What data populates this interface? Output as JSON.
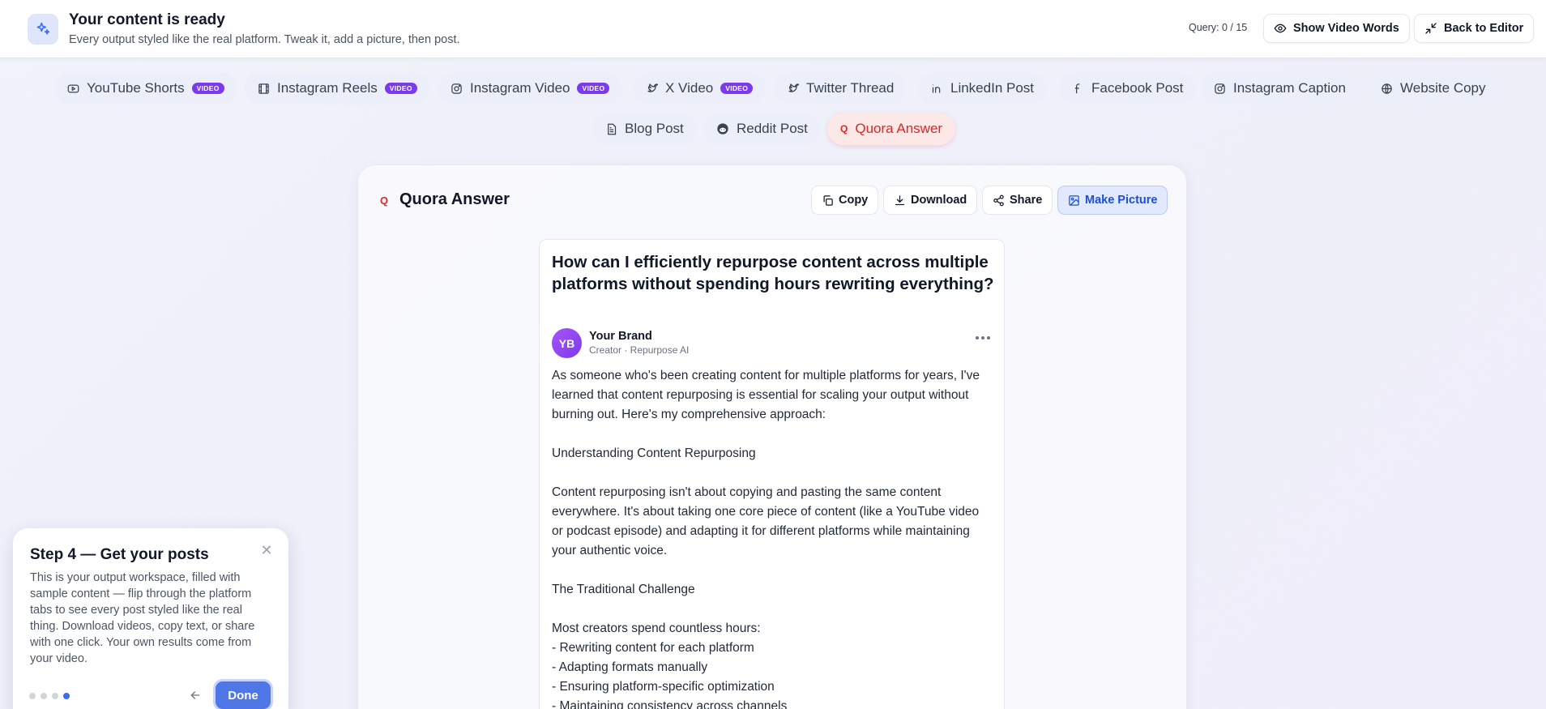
{
  "header": {
    "title": "Your content is ready",
    "subtitle": "Every output styled like the real platform. Tweak it, add a picture, then post.",
    "query": "Query: 0 / 15",
    "show_words_label": "Show Video Words",
    "back_label": "Back to Editor",
    "logo_icon": "sparkles-icon"
  },
  "tabs": [
    {
      "label": "YouTube Shorts",
      "badge": "VIDEO",
      "icon": "youtube-icon"
    },
    {
      "label": "Instagram Reels",
      "badge": "VIDEO",
      "icon": "film-icon"
    },
    {
      "label": "Instagram Video",
      "badge": "VIDEO",
      "icon": "instagram-icon"
    },
    {
      "label": "X Video",
      "badge": "VIDEO",
      "icon": "twitter-icon"
    },
    {
      "label": "Twitter Thread",
      "icon": "twitter-icon"
    },
    {
      "label": "LinkedIn Post",
      "icon": "linkedin-icon"
    },
    {
      "label": "Facebook Post",
      "icon": "facebook-icon"
    },
    {
      "label": "Instagram Caption",
      "icon": "instagram-icon"
    },
    {
      "label": "Website Copy",
      "icon": "globe-icon"
    },
    {
      "label": "Blog Post",
      "icon": "file-icon"
    },
    {
      "label": "Reddit Post",
      "icon": "reddit-icon"
    },
    {
      "label": "Quora Answer",
      "icon": "quora-icon",
      "active": true
    }
  ],
  "card": {
    "title": "Quora Answer",
    "copy_label": "Copy",
    "download_label": "Download",
    "share_label": "Share",
    "picture_label": "Make Picture"
  },
  "post": {
    "question": "How can I efficiently repurpose content across multiple platforms without spending hours rewriting everything?",
    "avatar_initials": "YB",
    "author": "Your Brand",
    "author_sub": "Creator · Repurpose AI",
    "paragraphs": [
      "As someone who's been creating content for multiple platforms for years, I've learned that content repurposing is essential for scaling your output without burning out. Here's my comprehensive approach:",
      "Understanding Content Repurposing",
      "Content repurposing isn't about copying and pasting the same content everywhere. It's about taking one core piece of content (like a YouTube video or podcast episode) and adapting it for different platforms while maintaining your authentic voice.",
      "The Traditional Challenge",
      "Most creators spend countless hours:\n- Rewriting content for each platform\n- Adapting formats manually\n- Ensuring platform-specific optimization\n- Maintaining consistency across channels"
    ]
  },
  "tour": {
    "title": "Step 4 — Get your posts",
    "body": "This is your output workspace, filled with sample content — flip through the platform tabs to see every post styled like the real thing. Download videos, copy text, or share with one click. Your own results come from your video.",
    "done_label": "Done",
    "step": 4,
    "total_steps": 4
  },
  "colors": {
    "accent": "#3b6cf0",
    "quora": "#dc2626",
    "video_badge": "#7c3aed"
  }
}
